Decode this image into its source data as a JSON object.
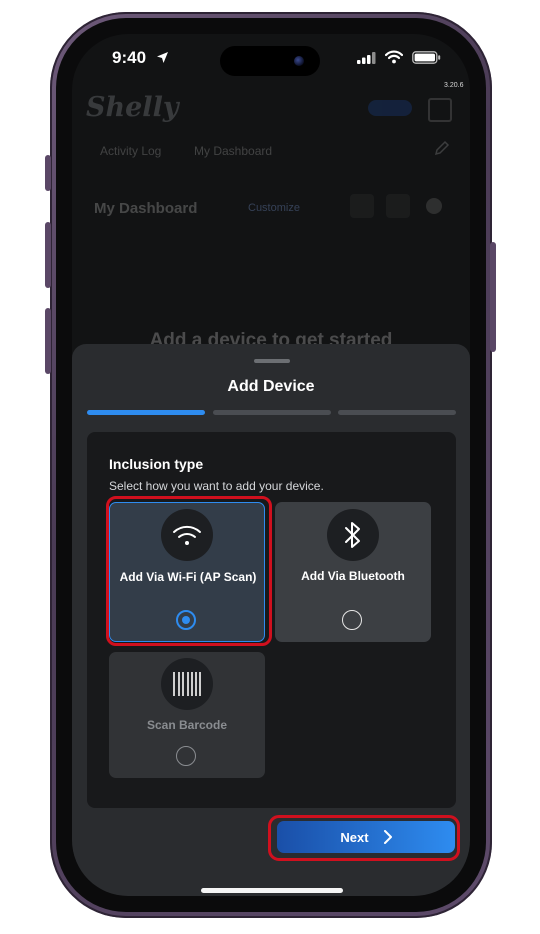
{
  "status_bar": {
    "time": "9:40",
    "icons": [
      "location-arrow-icon",
      "cellular-signal-icon",
      "wifi-icon",
      "battery-icon"
    ]
  },
  "app_version": "3.20.6",
  "background_app": {
    "brand": "Shelly",
    "tabs": [
      "Activity Log",
      "My Dashboard"
    ],
    "dashboard_title": "My Dashboard",
    "customize_label": "Customize",
    "empty_message": "Add a device to get started"
  },
  "sheet": {
    "title": "Add Device",
    "steps": [
      {
        "state": "active"
      },
      {
        "state": "inactive"
      },
      {
        "state": "inactive"
      }
    ],
    "section_title": "Inclusion type",
    "section_subtitle": "Select how you want to add your device.",
    "options": [
      {
        "label": "Add Via Wi-Fi (AP Scan)",
        "icon": "wifi-icon",
        "selected": true,
        "enabled": true
      },
      {
        "label": "Add Via Bluetooth",
        "icon": "bluetooth-icon",
        "selected": false,
        "enabled": true
      },
      {
        "label": "Scan Barcode",
        "icon": "barcode-icon",
        "selected": false,
        "enabled": false
      }
    ],
    "next_button": {
      "label": "Next",
      "icon": "chevron-right-icon"
    }
  },
  "colors": {
    "accent": "#2e8cf0",
    "highlight": "#d0101e",
    "sheet_background": "#2a2c2f",
    "card_background": "#18191b"
  }
}
